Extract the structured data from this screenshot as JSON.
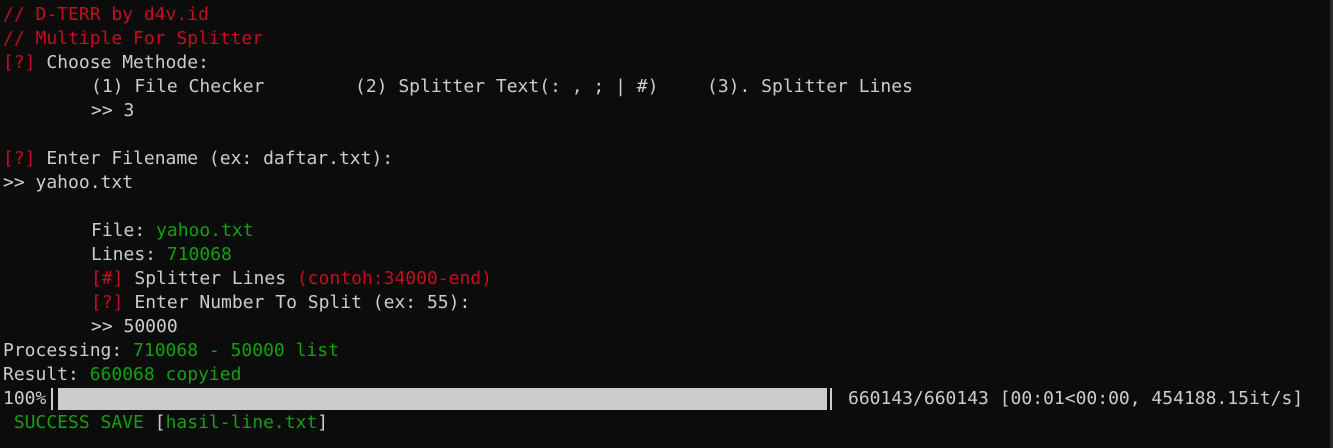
{
  "header": {
    "line1": "// D-TERR by d4v.id",
    "line2": "// Multiple For Splitter"
  },
  "menu": {
    "prompt_mark": "[?]",
    "prompt_text": " Choose Methode:",
    "option1": "(1) File Checker",
    "option2": "(2) Splitter Text(: , ; | #)",
    "option3": "(3). Splitter Lines",
    "choice": ">> 3"
  },
  "filename_prompt": {
    "mark": "[?]",
    "text": " Enter Filename (ex: daftar.txt):",
    "input": ">> yahoo.txt"
  },
  "file_info": {
    "file_label": "File: ",
    "file_value": "yahoo.txt",
    "lines_label": "Lines: ",
    "lines_value": "710068",
    "splitter_mark": "[#]",
    "splitter_text": " Splitter Lines ",
    "splitter_hint": "(contoh:34000-end)",
    "split_mark": "[?]",
    "split_text": " Enter Number To Split (ex: 55):",
    "split_input": ">> 50000"
  },
  "processing": {
    "label": "Processing: ",
    "value": "710068 - 50000 list"
  },
  "result": {
    "label": "Result: ",
    "value": "660068 copyied"
  },
  "progress": {
    "percent_label": "100%",
    "fraction": 1.0,
    "stats": "660143/660143 [00:01<00:00, 454188.15it/s]"
  },
  "success": {
    "text": " SUCCESS SAVE ",
    "bracket_open": "[",
    "filename": "hasil-line.txt",
    "bracket_close": "]"
  },
  "colors": {
    "background": "#0c0c0c",
    "text": "#cccccc",
    "red": "#c50f1f",
    "green": "#13a10e"
  }
}
